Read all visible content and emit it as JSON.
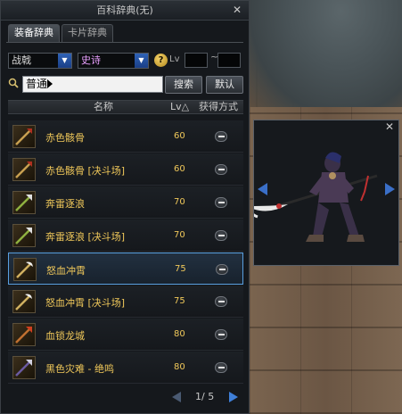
{
  "window": {
    "title": "百科辞典(无)"
  },
  "tabs": [
    {
      "label": "装备辞典",
      "active": true
    },
    {
      "label": "卡片辞典",
      "active": false
    }
  ],
  "filters": {
    "category": "战戟",
    "rarity": "史诗",
    "level_label": "Lv",
    "level_separator": "~",
    "level_min": "",
    "level_max": ""
  },
  "search": {
    "value": "普通",
    "search_button": "搜索",
    "default_button": "默认"
  },
  "list": {
    "headers": {
      "name": "名称",
      "lv": "Lv△",
      "obtain": "获得方式"
    },
    "rows": [
      {
        "name": "赤色骸骨",
        "lv": "60",
        "selected": false
      },
      {
        "name": "赤色骸骨 [决斗场]",
        "lv": "60",
        "selected": false
      },
      {
        "name": "奔雷逐浪",
        "lv": "70",
        "selected": false
      },
      {
        "name": "奔雷逐浪 [决斗场]",
        "lv": "70",
        "selected": false
      },
      {
        "name": "怒血冲霄",
        "lv": "75",
        "selected": true
      },
      {
        "name": "怒血冲霄 [决斗场]",
        "lv": "75",
        "selected": false
      },
      {
        "name": "血锁龙城",
        "lv": "80",
        "selected": false
      },
      {
        "name": "黑色灾难 - 绝鸣",
        "lv": "80",
        "selected": false
      }
    ]
  },
  "pagination": {
    "text": "1/ 5"
  },
  "preview": {
    "close_icon": "close-icon"
  },
  "colors": {
    "item_name": "#f0c85a",
    "selected_border": "#5aa0e0",
    "accent_blue": "#3f7fd8"
  }
}
